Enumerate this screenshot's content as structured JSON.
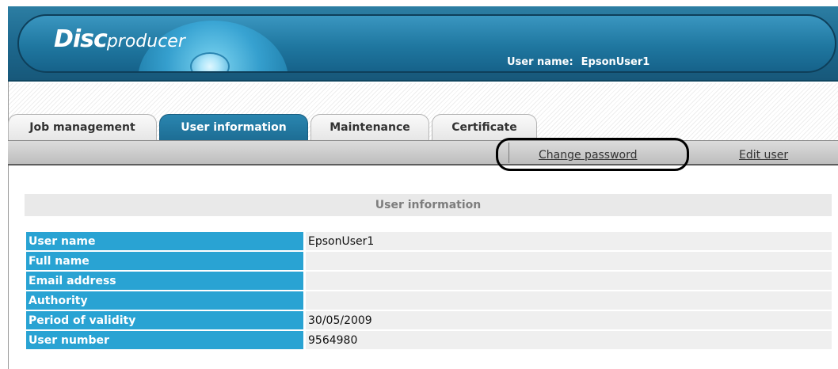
{
  "header": {
    "logo_disc": "Disc",
    "logo_producer": "producer",
    "user_label": "User name:",
    "user_value": "EpsonUser1"
  },
  "tabs": [
    {
      "label": "Job management",
      "active": false
    },
    {
      "label": "User information",
      "active": true
    },
    {
      "label": "Maintenance",
      "active": false
    },
    {
      "label": "Certificate",
      "active": false
    }
  ],
  "subnav": {
    "change_password": "Change password",
    "edit_user": "Edit user"
  },
  "user_info": {
    "heading": "User information",
    "rows": [
      {
        "label": "User name",
        "value": "EpsonUser1"
      },
      {
        "label": "Full name",
        "value": ""
      },
      {
        "label": "Email address",
        "value": ""
      },
      {
        "label": "Authority",
        "value": ""
      },
      {
        "label": "Period of validity",
        "value": "30/05/2009"
      },
      {
        "label": "User number",
        "value": "9564980"
      }
    ]
  },
  "colors": {
    "header_blue": "#1e6a90",
    "active_tab": "#1d6d94",
    "label_blue": "#29a3d3"
  }
}
